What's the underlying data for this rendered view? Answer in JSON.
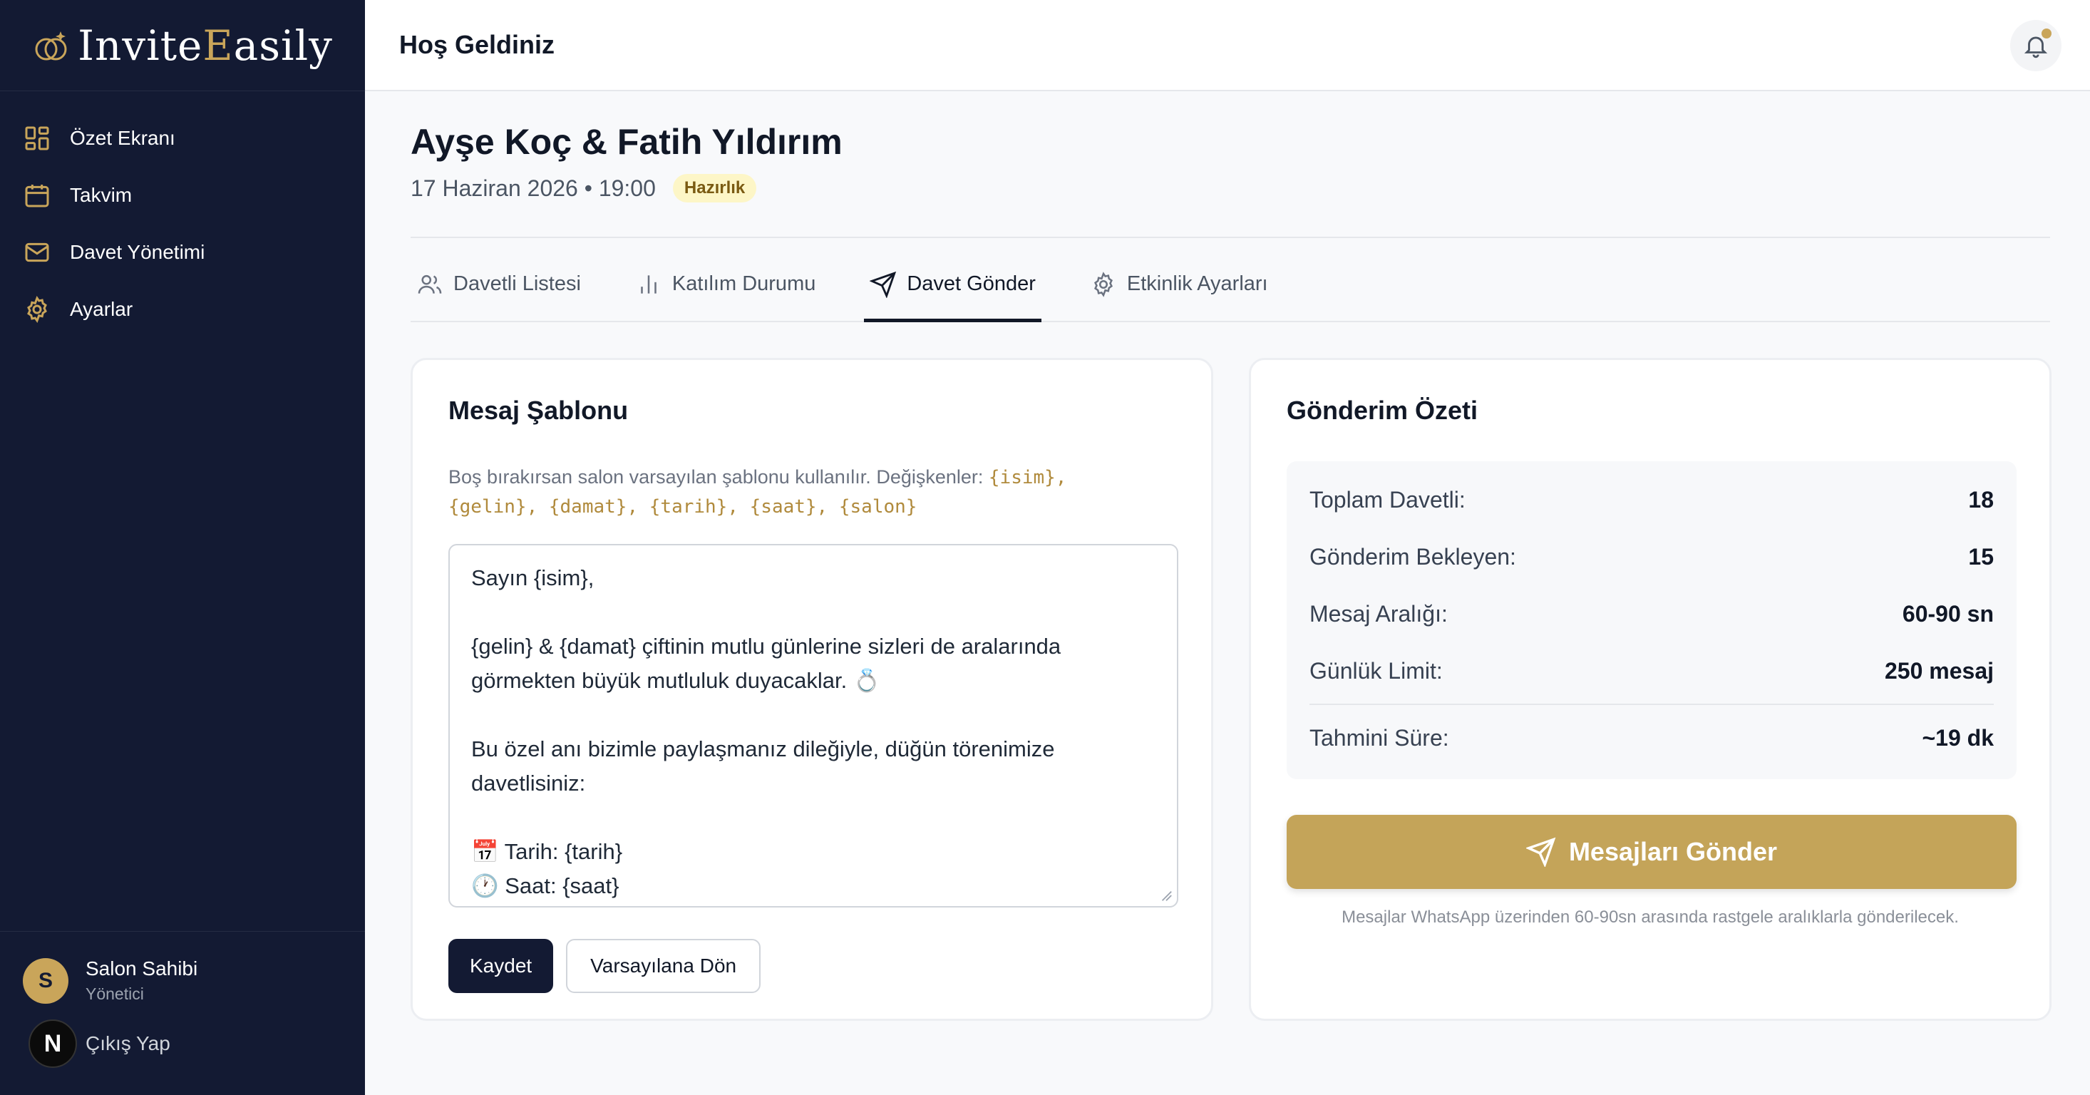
{
  "brand": {
    "name_part1": "Invite",
    "name_part2": "E",
    "name_part3": "asily",
    "accent_color": "#c9a55a"
  },
  "sidebar": {
    "items": [
      {
        "label": "Özet Ekranı",
        "icon": "grid-icon"
      },
      {
        "label": "Takvim",
        "icon": "calendar-icon"
      },
      {
        "label": "Davet Yönetimi",
        "icon": "mail-icon"
      },
      {
        "label": "Ayarlar",
        "icon": "gear-icon"
      }
    ],
    "user": {
      "initial": "S",
      "name": "Salon Sahibi",
      "role": "Yönetici"
    },
    "logout_badge": "N",
    "logout_label": "Çıkış Yap"
  },
  "topbar": {
    "title": "Hoş Geldiniz"
  },
  "event": {
    "title": "Ayşe Koç & Fatih Yıldırım",
    "date_time": "17 Haziran 2026 • 19:00",
    "status": "Hazırlık"
  },
  "tabs": [
    {
      "label": "Davetli Listesi",
      "icon": "users-icon",
      "active": false
    },
    {
      "label": "Katılım Durumu",
      "icon": "bar-chart-icon",
      "active": false
    },
    {
      "label": "Davet Gönder",
      "icon": "send-icon",
      "active": true
    },
    {
      "label": "Etkinlik Ayarları",
      "icon": "gear-icon",
      "active": false
    }
  ],
  "template_card": {
    "title": "Mesaj Şablonu",
    "hint_text": "Boş bırakırsan salon varsayılan şablonu kullanılır. Değişkenler: ",
    "hint_vars_line1": "{isim},",
    "hint_vars_line2": "{gelin}, {damat}, {tarih}, {saat}, {salon}",
    "template_text": "Sayın {isim},\n\n{gelin} & {damat} çiftinin mutlu günlerine sizleri de aralarında görmekten büyük mutluluk duyacaklar. 💍\n\nBu özel anı bizimle paylaşmanız dileğiyle, düğün törenimize davetlisiniz:\n\n📅 Tarih: {tarih}\n🕐 Saat: {saat}",
    "save_label": "Kaydet",
    "reset_label": "Varsayılana Dön"
  },
  "summary_card": {
    "title": "Gönderim Özeti",
    "rows": [
      {
        "label": "Toplam Davetli:",
        "value": "18"
      },
      {
        "label": "Gönderim Bekleyen:",
        "value": "15"
      },
      {
        "label": "Mesaj Aralığı:",
        "value": "60-90 sn"
      },
      {
        "label": "Günlük Limit:",
        "value": "250 mesaj"
      }
    ],
    "estimate_label": "Tahmini Süre:",
    "estimate_value": "~19 dk",
    "send_label": "Mesajları Gönder",
    "note": "Mesajlar WhatsApp üzerinden 60-90sn arasında rastgele aralıklarla gönderilecek."
  }
}
